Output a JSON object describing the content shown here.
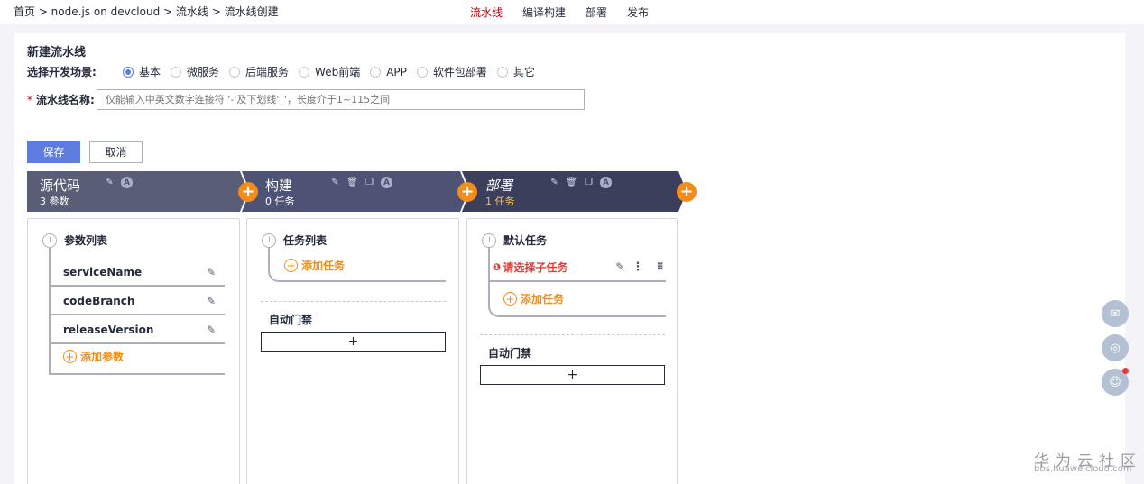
{
  "breadcrumb": "首页 > node.js on devcloud > 流水线 > 流水线创建",
  "topnav": [
    "流水线",
    "编译构建",
    "部署",
    "发布"
  ],
  "form": {
    "title": "新建流水线",
    "scene_label": "选择开发场景:",
    "scenes": [
      "基本",
      "微服务",
      "后端服务",
      "Web前端",
      "APP",
      "软件包部署",
      "其它"
    ],
    "selected_scene": "基本",
    "required_mark": "*",
    "name_label": "流水线名称:",
    "name_placeholder": "仅能输入中英文数字连接符 '-'及下划线'_'，长度介于1~115之间"
  },
  "buttons": {
    "save": "保存",
    "cancel": "取消"
  },
  "stage_colors": {
    "source": "#5a5d76",
    "build": "#4e5376",
    "deploy": "#3b3f5c",
    "plus": "#f28c1b",
    "deploy_sub": "#f5c342"
  },
  "stages": [
    {
      "title": "源代码",
      "sub": "3 参数"
    },
    {
      "title": "构建",
      "sub": "0 任务"
    },
    {
      "title": "部署",
      "sub": "1 任务"
    }
  ],
  "source_col": {
    "group": "参数列表",
    "params": [
      "serviceName",
      "codeBranch",
      "releaseVersion"
    ],
    "add": "添加参数"
  },
  "build_col": {
    "group": "任务列表",
    "add": "添加任务",
    "gate": "自动门禁",
    "gate_btn": "+"
  },
  "deploy_col": {
    "group": "默认任务",
    "error": "请选择子任务",
    "add": "添加任务",
    "gate": "自动门禁",
    "gate_btn": "+"
  },
  "stage_icon_letter": "A",
  "watermark": {
    "line1": "华为云社区",
    "line2": "bbs.huaweicloud.com"
  }
}
